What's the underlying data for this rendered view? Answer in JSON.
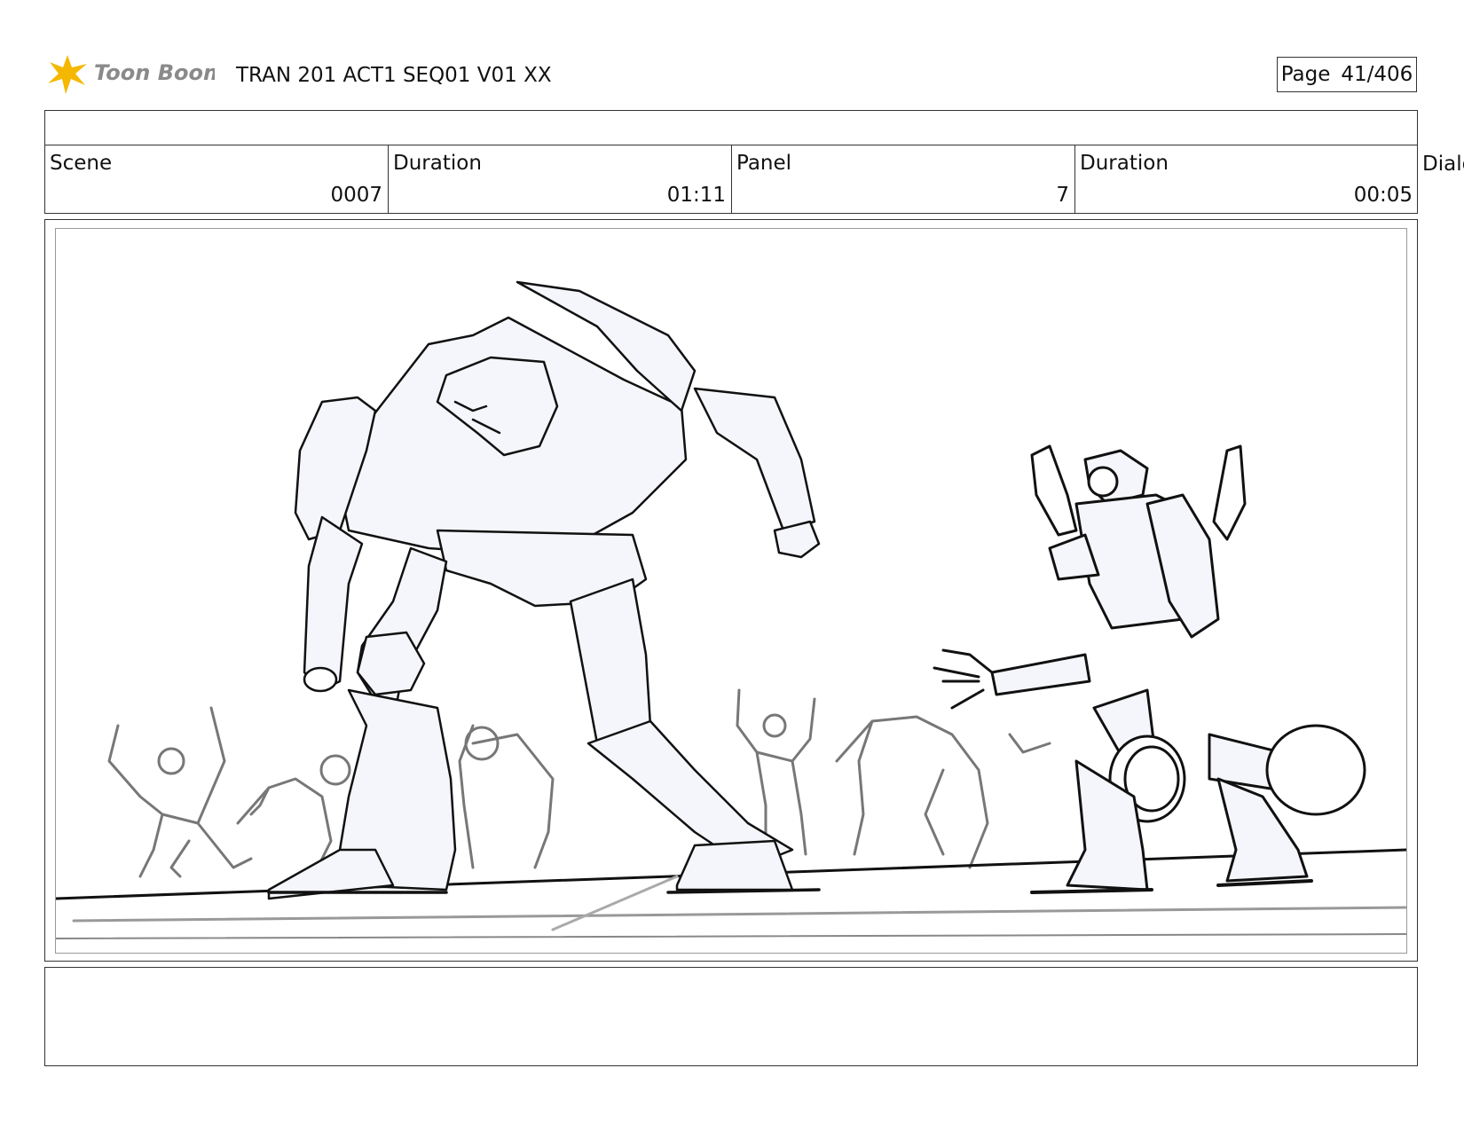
{
  "header": {
    "logo_text": "Toon Boom",
    "project_title": "TRAN 201 ACT1 SEQ01 V01 XX",
    "page_label": "Page",
    "page_number": "41/406"
  },
  "info": {
    "scene_label": "Scene",
    "scene_value": "0007",
    "scene_duration_label": "Duration",
    "scene_duration_value": "01:11",
    "panel_label": "Panel",
    "panel_value": "7",
    "panel_duration_label": "Duration",
    "panel_duration_value": "00:05",
    "dialog_label_partial": "Dialo"
  },
  "colors": {
    "logo_star": "#f5b800",
    "logo_text": "#8a8a8a",
    "sketch_line": "#111111",
    "background_crowd": "#777777",
    "fill_tint": "#f4f6fb"
  }
}
